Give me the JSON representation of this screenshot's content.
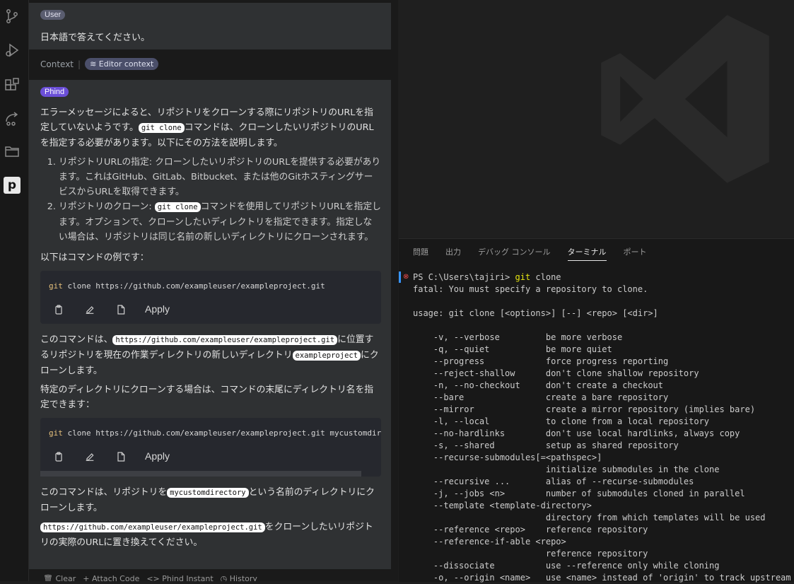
{
  "activity_bar": {
    "icons": [
      "source-control-icon",
      "run-debug-icon",
      "extensions-icon",
      "remote-icon",
      "explorer-icon",
      "phind-icon"
    ]
  },
  "chat": {
    "user_badge": "User",
    "user_message": "日本語で答えてください。",
    "context_label": "Context",
    "context_chip": "Editor context",
    "phind_badge": "Phind",
    "p1_a": "エラーメッセージによると、リポジトリをクローンする際にリポジトリのURLを指定していないようです。",
    "p1_code": "git clone",
    "p1_b": "コマンドは、クローンしたいリポジトリのURLを指定する必要があります。以下にその方法を説明します。",
    "li1": "リポジトリURLの指定: クローンしたいリポジトリのURLを提供する必要があります。これはGitHub、GitLab、Bitbucket、または他のGitホスティングサービスからURLを取得できます。",
    "li2_a": "リポジトリのクローン: ",
    "li2_code": "git clone",
    "li2_b": "コマンドを使用してリポジトリURLを指定します。オプションで、クローンしたいディレクトリを指定できます。指定しない場合は、リポジトリは同じ名前の新しいディレクトリにクローンされます。",
    "p2": "以下はコマンドの例です：",
    "code1_cmd": "git",
    "code1_rest": " clone https://github.com/exampleuser/exampleproject.git",
    "apply_label": "Apply",
    "p3_a": "このコマンドは、",
    "p3_code1": "https://github.com/exampleuser/exampleproject.git",
    "p3_b": "に位置するリポジトリを現在の作業ディレクトリの新しいディレクトリ",
    "p3_code2": "exampleproject",
    "p3_c": "にクローンします。",
    "p4": "特定のディレクトリにクローンする場合は、コマンドの末尾にディレクトリ名を指定できます：",
    "code2_cmd": "git",
    "code2_rest": " clone https://github.com/exampleuser/exampleproject.git mycustomdirecto",
    "p5_a": "このコマンドは、リポジトリを",
    "p5_code": "mycustomdirectory",
    "p5_b": "という名前のディレクトリにクローンします。",
    "p6_code": "https://github.com/exampleuser/exampleproject.git",
    "p6_b": "をクローンしたいリポジトリの実際のURLに置き換えてください。",
    "toolbar": [
      "Clear",
      "+ Attach Code",
      "<> Phind Instant",
      "History"
    ]
  },
  "panel": {
    "tabs": [
      "問題",
      "出力",
      "デバッグ コンソール",
      "ターミナル",
      "ポート"
    ],
    "active_tab": "ターミナル",
    "prompt": "PS C:\\Users\\tajiri> ",
    "prompt_cmd": "git",
    "prompt_rest": " clone",
    "terminal_lines": "fatal: You must specify a repository to clone.\n\nusage: git clone [<options>] [--] <repo> [<dir>]\n\n    -v, --verbose         be more verbose\n    -q, --quiet           be more quiet\n    --progress            force progress reporting\n    --reject-shallow      don't clone shallow repository\n    -n, --no-checkout     don't create a checkout\n    --bare                create a bare repository\n    --mirror              create a mirror repository (implies bare)\n    -l, --local           to clone from a local repository\n    --no-hardlinks        don't use local hardlinks, always copy\n    -s, --shared          setup as shared repository\n    --recurse-submodules[=<pathspec>]\n                          initialize submodules in the clone\n    --recursive ...       alias of --recurse-submodules\n    -j, --jobs <n>        number of submodules cloned in parallel\n    --template <template-directory>\n                          directory from which templates will be used\n    --reference <repo>    reference repository\n    --reference-if-able <repo>\n                          reference repository\n    --dissociate          use --reference only while cloning\n    -o, --origin <name>   use <name> instead of 'origin' to track upstream"
  }
}
